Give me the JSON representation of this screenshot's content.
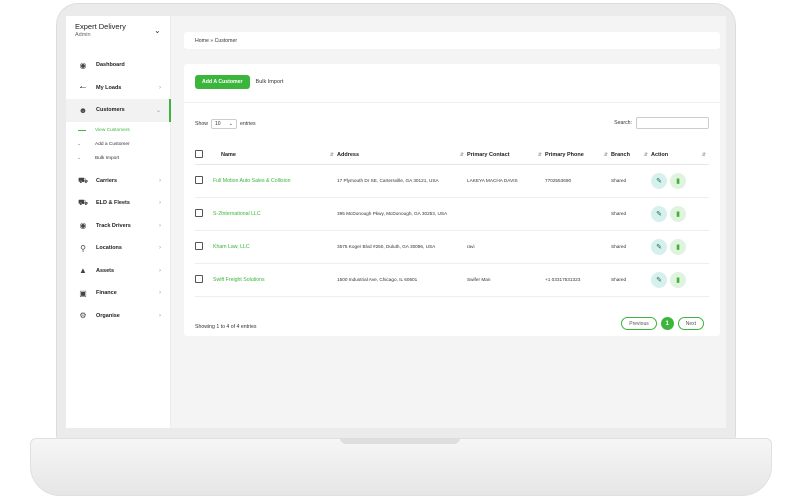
{
  "brand": {
    "name": "Expert Delivery",
    "role": "Admin"
  },
  "sidebar": {
    "items": [
      {
        "label": "Dashboard",
        "icon": "dashboard-icon"
      },
      {
        "label": "My Loads",
        "icon": "truck-icon"
      },
      {
        "label": "Customers",
        "icon": "add-user-icon"
      },
      {
        "label": "Carriers",
        "icon": "truck-icon"
      },
      {
        "label": "ELD & Fleets",
        "icon": "truck-icon"
      },
      {
        "label": "Track Drivers",
        "icon": "location-pin-icon"
      },
      {
        "label": "Locations",
        "icon": "map-pin-icon"
      },
      {
        "label": "Assets",
        "icon": "bag-icon"
      },
      {
        "label": "Finance",
        "icon": "card-icon"
      },
      {
        "label": "Organise",
        "icon": "gear-icon"
      }
    ],
    "customers_sub": [
      "View Customers",
      "Add a Customer",
      "Bulk Import"
    ]
  },
  "breadcrumb": "Home » Customer",
  "toolbar": {
    "add_label": "Add A Customer",
    "bulk_label": "Bulk Import"
  },
  "table_controls": {
    "show": "Show",
    "entries_value": "10",
    "entries": "entries",
    "search_label": "Search:"
  },
  "table": {
    "headers": [
      "Name",
      "Address",
      "Primary Contact",
      "Primary Phone",
      "Branch",
      "Action"
    ],
    "rows": [
      {
        "name": "Full Motion Auto Sales & Collision",
        "address": "17 Plymouth Dr SE, Cartersville, GA 30121, USA",
        "contact": "LAKEYA MACHA DAVIS",
        "phone": "7702553690",
        "branch": "Shared"
      },
      {
        "name": "S-2International LLC",
        "address": "395 McDonough Pkwy, McDonough, GA 30253, USA",
        "contact": "",
        "phone": "",
        "branch": "Shared"
      },
      {
        "name": "Kham Law, LLC",
        "address": "3575 Koger Blvd #250, Duluth, GA 30096, USA",
        "contact": "ravi",
        "phone": "",
        "branch": "Shared"
      },
      {
        "name": "Swift Freight Solutions",
        "address": "1500 Industrial Ave, Chicago, IL 60601",
        "contact": "Swifer Man",
        "phone": "+1 03317531323",
        "branch": "Shared"
      }
    ]
  },
  "footer": {
    "showing": "Showing 1 to 4 of 4 entries",
    "previous": "Previous",
    "page": "1",
    "next": "Next"
  },
  "colors": {
    "accent": "#3bb53b"
  }
}
